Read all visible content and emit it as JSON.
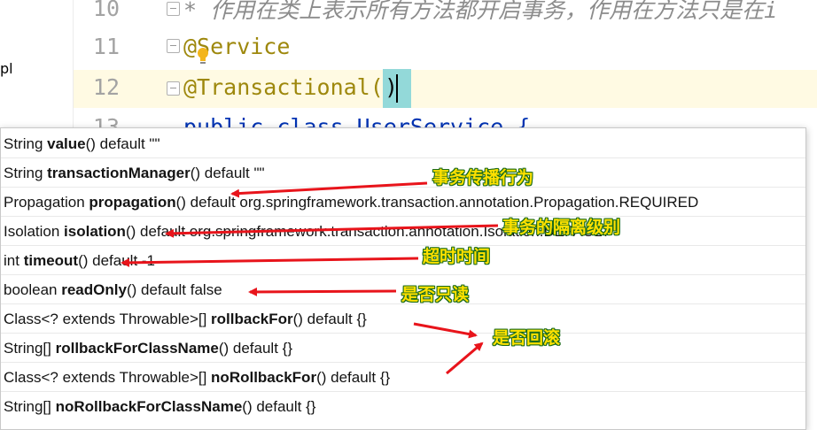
{
  "sidebar": {
    "fragment": "pl"
  },
  "editor": {
    "lines": [
      {
        "number": "10",
        "text": "* 作用在类上表示所有方法都开启事务，作用在方法只是在i"
      },
      {
        "number": "11",
        "text": "@Service"
      },
      {
        "number": "12",
        "text": "@Transactional(",
        "closing": ")"
      },
      {
        "number": "13",
        "text": "public class UserService {"
      }
    ]
  },
  "completion": {
    "items": [
      {
        "type": "String ",
        "name": "value",
        "rest": "() default \"\""
      },
      {
        "type": "String ",
        "name": "transactionManager",
        "rest": "() default \"\""
      },
      {
        "type": "Propagation ",
        "name": "propagation",
        "rest": "() default org.springframework.transaction.annotation.Propagation.REQUIRED"
      },
      {
        "type": "Isolation ",
        "name": "isolation",
        "rest": "() default org.springframework.transaction.annotation.Isolation.DEFAULT"
      },
      {
        "type": "int ",
        "name": "timeout",
        "rest": "() default -1"
      },
      {
        "type": "boolean ",
        "name": "readOnly",
        "rest": "() default false"
      },
      {
        "type": "Class<? extends Throwable>[] ",
        "name": "rollbackFor",
        "rest": "() default {}"
      },
      {
        "type": "String[] ",
        "name": "rollbackForClassName",
        "rest": "() default {}"
      },
      {
        "type": "Class<? extends Throwable>[] ",
        "name": "noRollbackFor",
        "rest": "() default {}"
      },
      {
        "type": "String[] ",
        "name": "noRollbackForClassName",
        "rest": "() default {}"
      }
    ]
  },
  "annotations": {
    "propagation": "事务传播行为",
    "isolation": "事务的隔离级别",
    "timeout": "超时时间",
    "readonly": "是否只读",
    "rollback": "是否回滚"
  },
  "colors": {
    "arrow": "#e8141b",
    "label_fill": "#ffe100",
    "label_outline": "#1a6b1a",
    "current_line": "#fffae3",
    "paren_highlight": "#93d9d9"
  }
}
